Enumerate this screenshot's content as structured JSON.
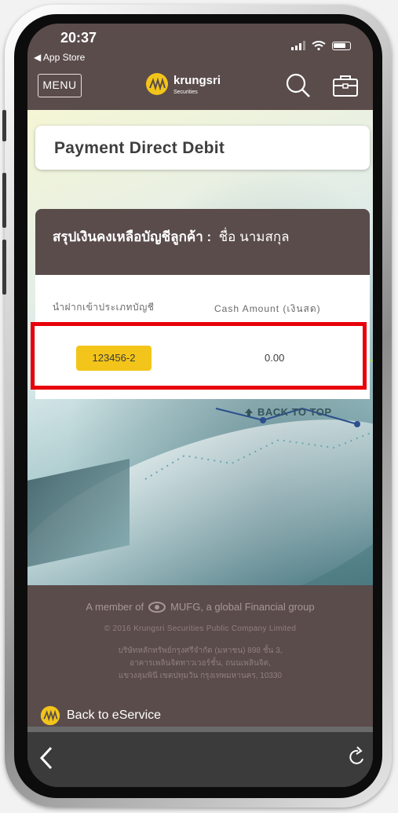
{
  "status_bar": {
    "time": "20:37",
    "back_app": "◀ App Store"
  },
  "header": {
    "menu_label": "MENU",
    "logo_name": "krungsri",
    "logo_sub": "Securities"
  },
  "page": {
    "title": "Payment Direct Debit"
  },
  "summary": {
    "title": "สรุปเงินคงเหลือบัญชีลูกค้า :",
    "customer_name": "ชื่อ นามสกุล",
    "col_account": "นำฝากเข้าประเภทบัญชี",
    "col_cash": "Cash Amount (เงินสด)",
    "rows": [
      {
        "account": "123456-2",
        "cash": "0.00"
      }
    ]
  },
  "back_to_top": "BACK TO TOP",
  "footer": {
    "member_prefix": "A member of",
    "member_suffix": "MUFG, a global Financial group",
    "copyright": "© 2016 Krungsri Securities Public Company Limited",
    "address_line1": "บริษัทหลักทรัพย์กรุงศรีจำกัด (มหาชน) 898 ชั้น 3,",
    "address_line2": "อาคารเพลินจิตทาวเวอร์ชั้น, ถนนเพลินจิต,",
    "address_line3": "แขวงลุมพินี เขตปทุมวัน กรุงเทพมหานคร, 10330",
    "back_eservice": "Back to eService"
  },
  "colors": {
    "brand_brown": "#5a4c4b",
    "accent_yellow": "#f3c51a",
    "highlight_red": "#e8000a"
  },
  "icons": [
    "signal-icon",
    "wifi-icon",
    "battery-icon",
    "search-icon",
    "briefcase-icon",
    "krungsri-logo-icon",
    "mufg-logo-icon",
    "back-arrow-icon",
    "refresh-icon"
  ]
}
